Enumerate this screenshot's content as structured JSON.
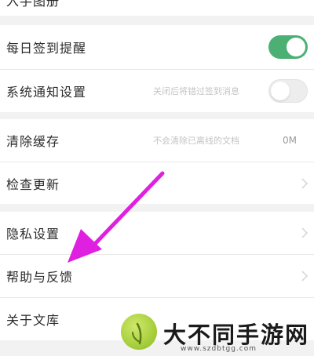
{
  "colors": {
    "accent_green": "#4caf74",
    "arrow_magenta": "#e020e0",
    "background": "#f2f2f2"
  },
  "top_partial": {
    "label": "入手图册",
    "value": ""
  },
  "settings": {
    "checkin_reminder": {
      "label": "每日签到提醒",
      "toggle_on": true
    },
    "system_notifications": {
      "label": "系统通知设置",
      "hint": "关闭后将错过签到消息",
      "toggle_on": false
    },
    "clear_cache": {
      "label": "清除缓存",
      "hint": "不会清除已离线的文档",
      "value": "0M"
    },
    "check_update": {
      "label": "检查更新"
    },
    "privacy": {
      "label": "隐私设置"
    },
    "help_feedback": {
      "label": "帮助与反馈"
    },
    "about": {
      "label": "关于文库"
    }
  },
  "icons": {
    "chevron": "chevron-right-icon"
  },
  "watermark": {
    "title": "大不同手游网",
    "url": "www.szdbtgg.com"
  }
}
